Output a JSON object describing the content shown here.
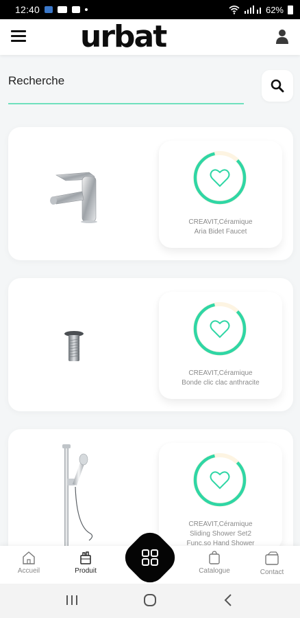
{
  "status_bar": {
    "time": "12:40",
    "battery": "62%"
  },
  "header": {
    "logo": "urbat"
  },
  "search": {
    "placeholder": "Recherche"
  },
  "products": [
    {
      "brand": "CREAVIT,Céramique",
      "name": "Aria Bidet Faucet"
    },
    {
      "brand": "CREAVIT,Céramique",
      "name": "Bonde clic clac anthracite"
    },
    {
      "brand": "CREAVIT,Céramique",
      "name": "Sliding Shower Set2",
      "name_extra": "Func.so Hand Shower"
    }
  ],
  "bottom_nav": {
    "items": [
      {
        "label": "Accueil",
        "icon": "home-icon"
      },
      {
        "label": "Produit",
        "icon": "product-icon"
      },
      {
        "label": "Catalogue",
        "icon": "catalogue-icon"
      },
      {
        "label": "Contact",
        "icon": "contact-icon"
      }
    ],
    "active": "Produit"
  },
  "colors": {
    "accent": "#2fd6a5",
    "fab": "#050505"
  }
}
